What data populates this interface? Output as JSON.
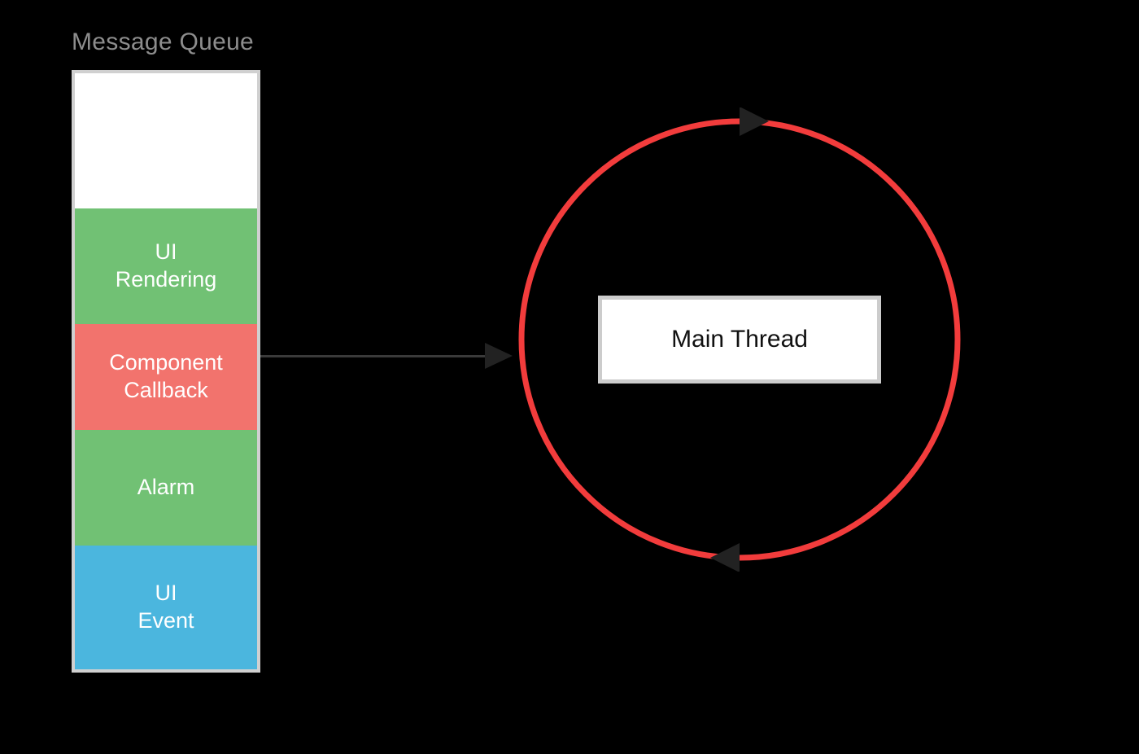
{
  "queue": {
    "title": "Message Queue",
    "items": [
      {
        "label": "UI\nRendering",
        "color": "green"
      },
      {
        "label": "Component\nCallback",
        "color": "red"
      },
      {
        "label": "Alarm",
        "color": "green"
      },
      {
        "label": "UI\nEvent",
        "color": "blue"
      }
    ]
  },
  "main_thread": {
    "label": "Main Thread"
  },
  "colors": {
    "loop": "#f23c3c",
    "arrow": "#222222",
    "green": "#71c174",
    "red": "#f2736d",
    "blue": "#4bb6de"
  }
}
